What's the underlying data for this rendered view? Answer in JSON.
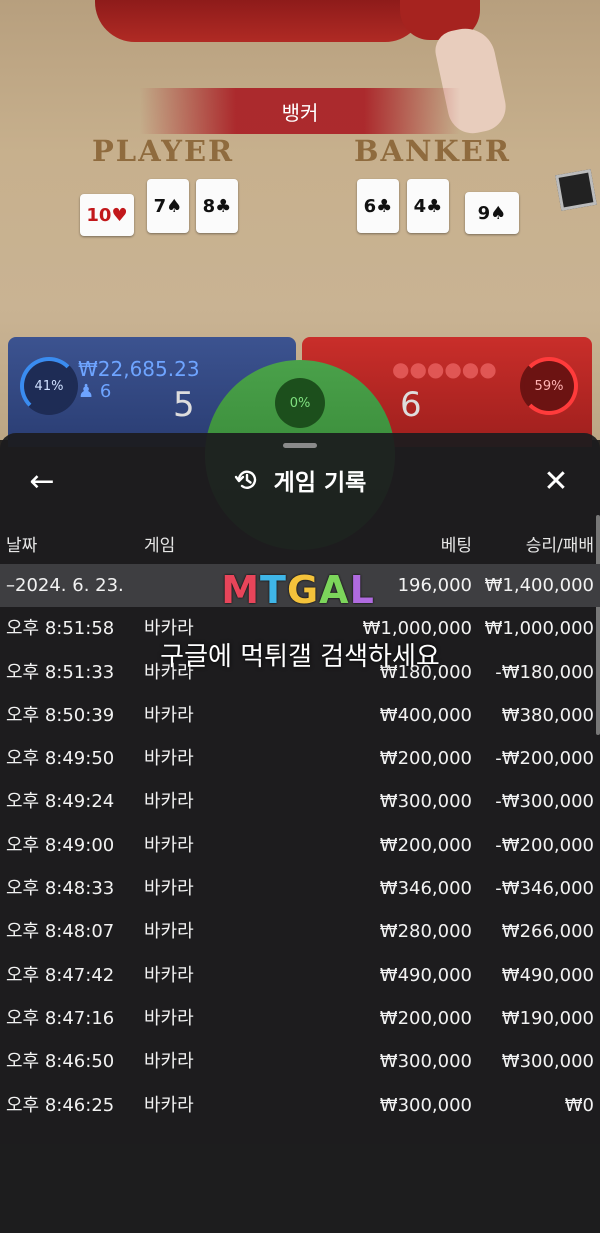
{
  "game": {
    "result_label": "뱅커",
    "player_label": "PLAYER",
    "banker_label": "BANKER",
    "player_cards": [
      "10♥",
      "7♠",
      "8♣"
    ],
    "banker_cards": [
      "6♣",
      "4♣",
      "9♠"
    ],
    "player": {
      "percent": "41%",
      "amount": "₩22,685.23",
      "count": "6",
      "score": "5"
    },
    "tie": {
      "percent": "0%"
    },
    "banker": {
      "percent": "59%",
      "score": "6"
    }
  },
  "sheet": {
    "title": "게임 기록",
    "back_icon": "←",
    "close_icon": "✕",
    "headers": {
      "date": "날짜",
      "game": "게임",
      "bet": "베팅",
      "win": "승리/패배"
    },
    "summary": {
      "date": "–2024. 6. 23.",
      "bet": "196,000",
      "win": "₩1,400,000"
    },
    "rows": [
      {
        "date": "오후 8:51:58",
        "game": "바카라",
        "bet": "₩1,000,000",
        "win": "₩1,000,000"
      },
      {
        "date": "오후 8:51:33",
        "game": "바카라",
        "bet": "₩180,000",
        "win": "-₩180,000"
      },
      {
        "date": "오후 8:50:39",
        "game": "바카라",
        "bet": "₩400,000",
        "win": "₩380,000"
      },
      {
        "date": "오후 8:49:50",
        "game": "바카라",
        "bet": "₩200,000",
        "win": "-₩200,000"
      },
      {
        "date": "오후 8:49:24",
        "game": "바카라",
        "bet": "₩300,000",
        "win": "-₩300,000"
      },
      {
        "date": "오후 8:49:00",
        "game": "바카라",
        "bet": "₩200,000",
        "win": "-₩200,000"
      },
      {
        "date": "오후 8:48:33",
        "game": "바카라",
        "bet": "₩346,000",
        "win": "-₩346,000"
      },
      {
        "date": "오후 8:48:07",
        "game": "바카라",
        "bet": "₩280,000",
        "win": "₩266,000"
      },
      {
        "date": "오후 8:47:42",
        "game": "바카라",
        "bet": "₩490,000",
        "win": "₩490,000"
      },
      {
        "date": "오후 8:47:16",
        "game": "바카라",
        "bet": "₩200,000",
        "win": "₩190,000"
      },
      {
        "date": "오후 8:46:50",
        "game": "바카라",
        "bet": "₩300,000",
        "win": "₩300,000"
      },
      {
        "date": "오후 8:46:25",
        "game": "바카라",
        "bet": "₩300,000",
        "win": "₩0"
      }
    ]
  },
  "watermark": {
    "logo": "MTGAL",
    "logo_colors": [
      "#e8455a",
      "#3fb6e8",
      "#f5c33b",
      "#7cd55b",
      "#b06be0"
    ],
    "text": "구글에 먹튀갤 검색하세요"
  }
}
